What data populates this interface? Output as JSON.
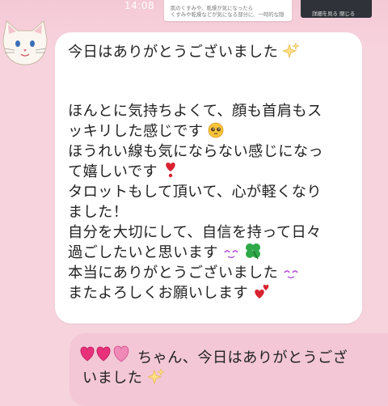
{
  "status_bar": {
    "time": "14:08"
  },
  "background_preview": {
    "line1": "肌のくすみや、乾燥が気になったら",
    "line2": "くすみや乾燥などが気になる部分に、一時的な隠",
    "dark_text": "詳細を見る  閉じる"
  },
  "contact": {
    "avatar_icon": "white-cat-avatar-icon"
  },
  "incoming_message": {
    "lines": [
      "今日はありがとうございました",
      "",
      "",
      "ほんとに気持ちよくて、顔も首肩もス",
      "ッキリした感じです",
      "ほうれい線も気にならない感じになっ",
      "て嬉しいです",
      "タロットもして頂いて、心が軽くなり",
      "ました！",
      "自分を大切にして、自信を持って日々",
      "過ごしたいと思います",
      "本当にありがとうございました",
      "またよろしくお願いします"
    ],
    "emoji": {
      "line1": "sparkles-icon",
      "line5": "pleading-face-icon",
      "line7": "red-heart-exclamation-icon",
      "line11_a": "smiling-eyes-icon",
      "line11_b": "four-leaf-clover-icon",
      "line12": "smiling-eyes-icon",
      "line13": "two-hearts-icon"
    }
  },
  "outgoing_message": {
    "line1": "ちゃん、今日はありがとうござ",
    "line2": "いました",
    "leading_icon": "pink-hearts-icon",
    "trailing_icon": "sparkles-icon"
  },
  "colors": {
    "background": "#f7d3de",
    "incoming_bubble": "#ffffff",
    "outgoing_bubble": "#f3c7d6",
    "heart_pink": "#e9307a",
    "heart_red": "#d8232f"
  }
}
